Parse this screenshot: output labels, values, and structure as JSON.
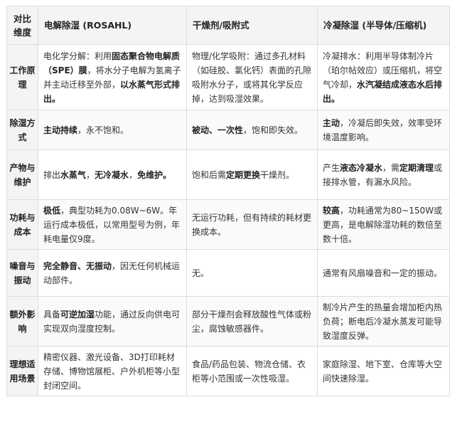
{
  "header": {
    "dimension": "对比维度",
    "col1": "电解除湿 (ROSAHL)",
    "col2": "干燥剂/吸附式",
    "col3": "冷凝除湿 (半导体/压缩机)"
  },
  "rows": [
    {
      "label": "工作原理",
      "c1": [
        {
          "t": "电化学分解：利用",
          "b": false
        },
        {
          "t": "固态聚合物电解质（SPE）膜",
          "b": true
        },
        {
          "t": "，将水分子电解为氢离子并主动迁移至外部，",
          "b": false
        },
        {
          "t": "以水蒸气形式排出。",
          "b": true
        }
      ],
      "c2": [
        {
          "t": "物理/化学吸附：通过多孔材料（如硅胶、氯化钙）表面的孔隙吸附水分子，或将其化学反应掉，达到吸湿效果。",
          "b": false
        }
      ],
      "c3": [
        {
          "t": "冷凝排水：利用半导体制冷片（珀尔帖效应）或压缩机，将空气冷却，",
          "b": false
        },
        {
          "t": "水汽凝结成液态水后排出。",
          "b": true
        }
      ]
    },
    {
      "label": "除湿方式",
      "c1": [
        {
          "t": "主动持续",
          "b": true
        },
        {
          "t": "，永不饱和。",
          "b": false
        }
      ],
      "c2": [
        {
          "t": "被动、一次性",
          "b": true
        },
        {
          "t": "，饱和即失效。",
          "b": false
        }
      ],
      "c3": [
        {
          "t": "主动",
          "b": true
        },
        {
          "t": "，冷凝后即失效，效率受环境温度影响。",
          "b": false
        }
      ]
    },
    {
      "label": "产物与维护",
      "c1": [
        {
          "t": "排出",
          "b": false
        },
        {
          "t": "水蒸气",
          "b": true
        },
        {
          "t": "，",
          "b": false
        },
        {
          "t": "无冷凝水",
          "b": true
        },
        {
          "t": "，",
          "b": false
        },
        {
          "t": "免维护。",
          "b": true
        }
      ],
      "c2": [
        {
          "t": "饱和后需",
          "b": false
        },
        {
          "t": "定期更换",
          "b": true
        },
        {
          "t": "干燥剂。",
          "b": false
        }
      ],
      "c3": [
        {
          "t": "产生",
          "b": false
        },
        {
          "t": "液态冷凝水",
          "b": true
        },
        {
          "t": "，需",
          "b": false
        },
        {
          "t": "定期清理",
          "b": true
        },
        {
          "t": "或接排水管，有漏水风险。",
          "b": false
        }
      ]
    },
    {
      "label": "功耗与成本",
      "c1": [
        {
          "t": "极低",
          "b": true
        },
        {
          "t": "，典型功耗为0.08W~6W。年运行成本极低，以常用型号为例，年耗电量仅9度。",
          "b": false
        }
      ],
      "c2": [
        {
          "t": "无运行功耗，但有持续的耗材更换成本。",
          "b": false
        }
      ],
      "c3": [
        {
          "t": "较高",
          "b": true
        },
        {
          "t": "，功耗通常为80~150W或更高，是电解除湿功耗的数倍至数十倍。",
          "b": false
        }
      ]
    },
    {
      "label": "噪音与振动",
      "c1": [
        {
          "t": "完全静音、无振动",
          "b": true
        },
        {
          "t": "，因无任何机械运动部件。",
          "b": false
        }
      ],
      "c2": [
        {
          "t": "无。",
          "b": false
        }
      ],
      "c3": [
        {
          "t": "通常有风扇噪音和一定的振动。",
          "b": false
        }
      ]
    },
    {
      "label": "额外影响",
      "c1": [
        {
          "t": "具备",
          "b": false
        },
        {
          "t": "可逆加湿",
          "b": true
        },
        {
          "t": "功能，通过反向供电可实现双向湿度控制。",
          "b": false
        }
      ],
      "c2": [
        {
          "t": "部分干燥剂会释放酸性气体或粉尘，腐蚀敏感器件。",
          "b": false
        }
      ],
      "c3": [
        {
          "t": "制冷片产生的热量会增加柜内热负荷；断电后冷凝水蒸发可能导致湿度反弹。",
          "b": false
        }
      ]
    },
    {
      "label": "理想适用场景",
      "c1": [
        {
          "t": "精密仪器、激光设备、3D打印耗材存储、博物馆展柜、户外机柜等小型封闭空间。",
          "b": false
        }
      ],
      "c2": [
        {
          "t": "食品/药品包装、物流仓储、衣柜等小范围或一次性吸湿。",
          "b": false
        }
      ],
      "c3": [
        {
          "t": "家庭除湿、地下室、仓库等大空间快速除湿。",
          "b": false
        }
      ]
    }
  ]
}
